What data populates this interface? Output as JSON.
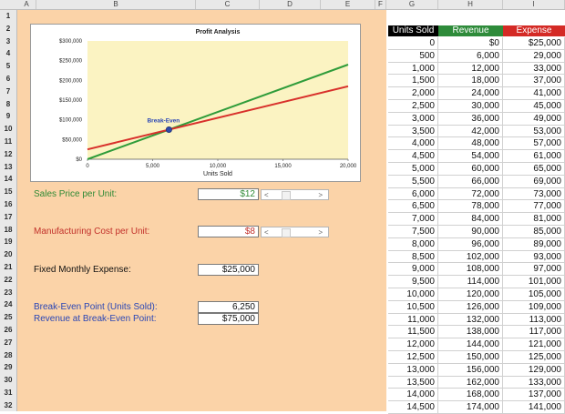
{
  "columns": [
    "A",
    "B",
    "C",
    "D",
    "E",
    "F",
    "G",
    "H",
    "I"
  ],
  "rows": [
    "1",
    "2",
    "3",
    "4",
    "5",
    "6",
    "7",
    "8",
    "9",
    "10",
    "11",
    "12",
    "13",
    "14",
    "15",
    "16",
    "17",
    "18",
    "19",
    "20",
    "21",
    "22",
    "23",
    "24",
    "25",
    "26",
    "27",
    "28",
    "29",
    "30",
    "31",
    "32"
  ],
  "chart_data": {
    "type": "line",
    "title": "Profit Analysis",
    "xlabel": "Units Sold",
    "ylabel": "",
    "xlim": [
      0,
      20000
    ],
    "ylim": [
      0,
      300000
    ],
    "x_ticks": [
      "0",
      "5,000",
      "10,000",
      "15,000",
      "20,000"
    ],
    "y_ticks": [
      "$0",
      "$50,000",
      "$100,000",
      "$150,000",
      "$200,000",
      "$250,000",
      "$300,000"
    ],
    "series": [
      {
        "color": "#2f9c3a",
        "x": [
          0,
          20000
        ],
        "y": [
          0,
          240000
        ]
      },
      {
        "color": "#d8302b",
        "x": [
          0,
          20000
        ],
        "y": [
          25000,
          185000
        ]
      }
    ],
    "annotation": {
      "label": "Break-Even",
      "x": 6250,
      "y": 75000
    }
  },
  "inputs": {
    "sales_price_label": "Sales Price per Unit:",
    "sales_price_value": "$12",
    "mfg_cost_label": "Manufacturing Cost per Unit:",
    "mfg_cost_value": "$8",
    "fixed_expense_label": "Fixed Monthly Expense:",
    "fixed_expense_value": "$25,000",
    "breakeven_units_label": "Break-Even Point (Units Sold):",
    "breakeven_units_value": "6,250",
    "breakeven_revenue_label": "Revenue at Break-Even Point:",
    "breakeven_revenue_value": "$75,000",
    "scroll_left": "<",
    "scroll_right": ">"
  },
  "table": {
    "headers": [
      "Units Sold",
      "Revenue",
      "Expense"
    ],
    "header_colors": [
      "#000000",
      "#2e8b3a",
      "#d42a25"
    ],
    "rows": [
      [
        "0",
        "$0",
        "$25,000"
      ],
      [
        "500",
        "6,000",
        "29,000"
      ],
      [
        "1,000",
        "12,000",
        "33,000"
      ],
      [
        "1,500",
        "18,000",
        "37,000"
      ],
      [
        "2,000",
        "24,000",
        "41,000"
      ],
      [
        "2,500",
        "30,000",
        "45,000"
      ],
      [
        "3,000",
        "36,000",
        "49,000"
      ],
      [
        "3,500",
        "42,000",
        "53,000"
      ],
      [
        "4,000",
        "48,000",
        "57,000"
      ],
      [
        "4,500",
        "54,000",
        "61,000"
      ],
      [
        "5,000",
        "60,000",
        "65,000"
      ],
      [
        "5,500",
        "66,000",
        "69,000"
      ],
      [
        "6,000",
        "72,000",
        "73,000"
      ],
      [
        "6,500",
        "78,000",
        "77,000"
      ],
      [
        "7,000",
        "84,000",
        "81,000"
      ],
      [
        "7,500",
        "90,000",
        "85,000"
      ],
      [
        "8,000",
        "96,000",
        "89,000"
      ],
      [
        "8,500",
        "102,000",
        "93,000"
      ],
      [
        "9,000",
        "108,000",
        "97,000"
      ],
      [
        "9,500",
        "114,000",
        "101,000"
      ],
      [
        "10,000",
        "120,000",
        "105,000"
      ],
      [
        "10,500",
        "126,000",
        "109,000"
      ],
      [
        "11,000",
        "132,000",
        "113,000"
      ],
      [
        "11,500",
        "138,000",
        "117,000"
      ],
      [
        "12,000",
        "144,000",
        "121,000"
      ],
      [
        "12,500",
        "150,000",
        "125,000"
      ],
      [
        "13,000",
        "156,000",
        "129,000"
      ],
      [
        "13,500",
        "162,000",
        "133,000"
      ],
      [
        "14,000",
        "168,000",
        "137,000"
      ],
      [
        "14,500",
        "174,000",
        "141,000"
      ]
    ]
  }
}
